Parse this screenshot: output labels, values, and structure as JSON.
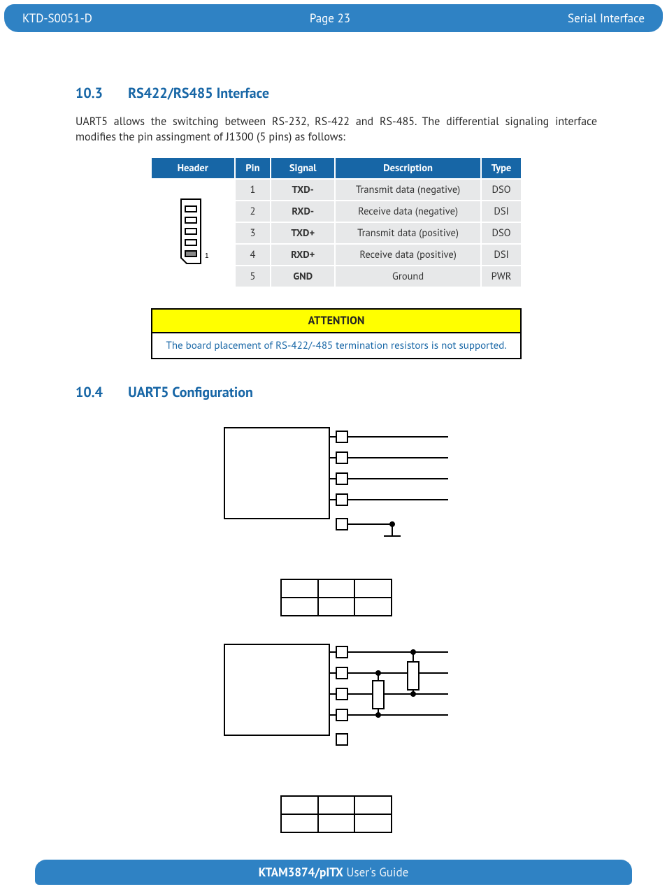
{
  "page": {
    "doc_code": "KTD-S0051-D",
    "page_label": "Page 23",
    "section_label": "Serial Interface"
  },
  "section_10_3": {
    "number": "10.3",
    "title": "RS422/RS485 Interface",
    "paragraph": "UART5 allows the switching between RS-232, RS-422 and RS-485. The differential signaling interface modifies the pin assingment of J1300 (5 pins) as follows:"
  },
  "pin_table": {
    "headers": {
      "header": "Header",
      "pin": "Pin",
      "signal": "Signal",
      "description": "Description",
      "type": "Type"
    },
    "header_caption": "1",
    "rows": [
      {
        "pin": "1",
        "signal": "TXD-",
        "desc": "Transmit data (negative)",
        "type": "DSO"
      },
      {
        "pin": "2",
        "signal": "RXD-",
        "desc": "Receive data (negative)",
        "type": "DSI"
      },
      {
        "pin": "3",
        "signal": "TXD+",
        "desc": "Transmit data (positive)",
        "type": "DSO"
      },
      {
        "pin": "4",
        "signal": "RXD+",
        "desc": "Receive data (positive)",
        "type": "DSI"
      },
      {
        "pin": "5",
        "signal": "GND",
        "desc": "Ground",
        "type": "PWR"
      }
    ]
  },
  "attention": {
    "title": "ATTENTION",
    "message": "The board placement of RS-422/-485 termination resistors is not supported."
  },
  "section_10_4": {
    "number": "10.4",
    "title": "UART5 Configuration"
  },
  "footer": {
    "product": "KTAM3874/pITX",
    "suffix": " User's Guide"
  }
}
